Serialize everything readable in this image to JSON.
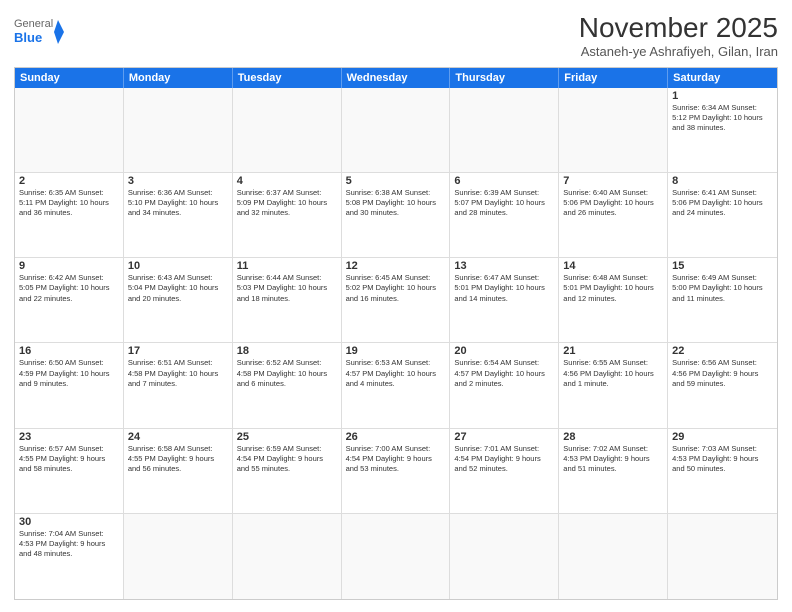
{
  "logo": {
    "text_general": "General",
    "text_blue": "Blue"
  },
  "header": {
    "month": "November 2025",
    "location": "Astaneh-ye Ashrafiyeh, Gilan, Iran"
  },
  "day_headers": [
    "Sunday",
    "Monday",
    "Tuesday",
    "Wednesday",
    "Thursday",
    "Friday",
    "Saturday"
  ],
  "weeks": [
    [
      {
        "day": "",
        "info": ""
      },
      {
        "day": "",
        "info": ""
      },
      {
        "day": "",
        "info": ""
      },
      {
        "day": "",
        "info": ""
      },
      {
        "day": "",
        "info": ""
      },
      {
        "day": "",
        "info": ""
      },
      {
        "day": "1",
        "info": "Sunrise: 6:34 AM\nSunset: 5:12 PM\nDaylight: 10 hours and 38 minutes."
      }
    ],
    [
      {
        "day": "2",
        "info": "Sunrise: 6:35 AM\nSunset: 5:11 PM\nDaylight: 10 hours and 36 minutes."
      },
      {
        "day": "3",
        "info": "Sunrise: 6:36 AM\nSunset: 5:10 PM\nDaylight: 10 hours and 34 minutes."
      },
      {
        "day": "4",
        "info": "Sunrise: 6:37 AM\nSunset: 5:09 PM\nDaylight: 10 hours and 32 minutes."
      },
      {
        "day": "5",
        "info": "Sunrise: 6:38 AM\nSunset: 5:08 PM\nDaylight: 10 hours and 30 minutes."
      },
      {
        "day": "6",
        "info": "Sunrise: 6:39 AM\nSunset: 5:07 PM\nDaylight: 10 hours and 28 minutes."
      },
      {
        "day": "7",
        "info": "Sunrise: 6:40 AM\nSunset: 5:06 PM\nDaylight: 10 hours and 26 minutes."
      },
      {
        "day": "8",
        "info": "Sunrise: 6:41 AM\nSunset: 5:06 PM\nDaylight: 10 hours and 24 minutes."
      }
    ],
    [
      {
        "day": "9",
        "info": "Sunrise: 6:42 AM\nSunset: 5:05 PM\nDaylight: 10 hours and 22 minutes."
      },
      {
        "day": "10",
        "info": "Sunrise: 6:43 AM\nSunset: 5:04 PM\nDaylight: 10 hours and 20 minutes."
      },
      {
        "day": "11",
        "info": "Sunrise: 6:44 AM\nSunset: 5:03 PM\nDaylight: 10 hours and 18 minutes."
      },
      {
        "day": "12",
        "info": "Sunrise: 6:45 AM\nSunset: 5:02 PM\nDaylight: 10 hours and 16 minutes."
      },
      {
        "day": "13",
        "info": "Sunrise: 6:47 AM\nSunset: 5:01 PM\nDaylight: 10 hours and 14 minutes."
      },
      {
        "day": "14",
        "info": "Sunrise: 6:48 AM\nSunset: 5:01 PM\nDaylight: 10 hours and 12 minutes."
      },
      {
        "day": "15",
        "info": "Sunrise: 6:49 AM\nSunset: 5:00 PM\nDaylight: 10 hours and 11 minutes."
      }
    ],
    [
      {
        "day": "16",
        "info": "Sunrise: 6:50 AM\nSunset: 4:59 PM\nDaylight: 10 hours and 9 minutes."
      },
      {
        "day": "17",
        "info": "Sunrise: 6:51 AM\nSunset: 4:58 PM\nDaylight: 10 hours and 7 minutes."
      },
      {
        "day": "18",
        "info": "Sunrise: 6:52 AM\nSunset: 4:58 PM\nDaylight: 10 hours and 6 minutes."
      },
      {
        "day": "19",
        "info": "Sunrise: 6:53 AM\nSunset: 4:57 PM\nDaylight: 10 hours and 4 minutes."
      },
      {
        "day": "20",
        "info": "Sunrise: 6:54 AM\nSunset: 4:57 PM\nDaylight: 10 hours and 2 minutes."
      },
      {
        "day": "21",
        "info": "Sunrise: 6:55 AM\nSunset: 4:56 PM\nDaylight: 10 hours and 1 minute."
      },
      {
        "day": "22",
        "info": "Sunrise: 6:56 AM\nSunset: 4:56 PM\nDaylight: 9 hours and 59 minutes."
      }
    ],
    [
      {
        "day": "23",
        "info": "Sunrise: 6:57 AM\nSunset: 4:55 PM\nDaylight: 9 hours and 58 minutes."
      },
      {
        "day": "24",
        "info": "Sunrise: 6:58 AM\nSunset: 4:55 PM\nDaylight: 9 hours and 56 minutes."
      },
      {
        "day": "25",
        "info": "Sunrise: 6:59 AM\nSunset: 4:54 PM\nDaylight: 9 hours and 55 minutes."
      },
      {
        "day": "26",
        "info": "Sunrise: 7:00 AM\nSunset: 4:54 PM\nDaylight: 9 hours and 53 minutes."
      },
      {
        "day": "27",
        "info": "Sunrise: 7:01 AM\nSunset: 4:54 PM\nDaylight: 9 hours and 52 minutes."
      },
      {
        "day": "28",
        "info": "Sunrise: 7:02 AM\nSunset: 4:53 PM\nDaylight: 9 hours and 51 minutes."
      },
      {
        "day": "29",
        "info": "Sunrise: 7:03 AM\nSunset: 4:53 PM\nDaylight: 9 hours and 50 minutes."
      }
    ],
    [
      {
        "day": "30",
        "info": "Sunrise: 7:04 AM\nSunset: 4:53 PM\nDaylight: 9 hours and 48 minutes."
      },
      {
        "day": "",
        "info": ""
      },
      {
        "day": "",
        "info": ""
      },
      {
        "day": "",
        "info": ""
      },
      {
        "day": "",
        "info": ""
      },
      {
        "day": "",
        "info": ""
      },
      {
        "day": "",
        "info": ""
      }
    ]
  ]
}
